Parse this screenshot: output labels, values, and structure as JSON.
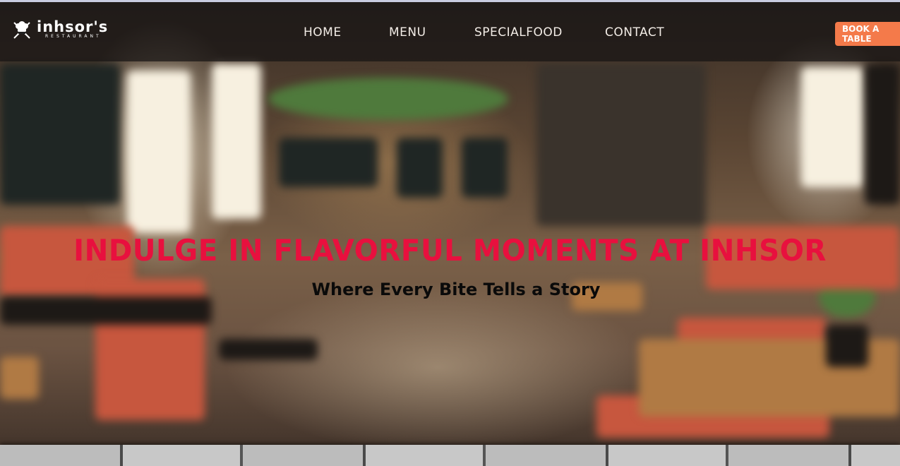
{
  "brand": {
    "name": "inhsor's",
    "tagline": "RESTAURANT",
    "logo_icon": "chef-hat-crossed-utensils-icon"
  },
  "nav": {
    "items": [
      {
        "label": "HOME"
      },
      {
        "label": "MENU"
      },
      {
        "label": "SPECIALFOOD"
      },
      {
        "label": "CONTACT"
      }
    ],
    "cta_label": "BOOK A TABLE"
  },
  "hero": {
    "title": "INDULGE IN FLAVORFUL MOMENTS AT INHSOR",
    "subtitle": "Where Every Bite Tells a Story"
  },
  "colors": {
    "accent": "#f47a4a",
    "title": "#e8103e",
    "nav_bg": "#161413"
  }
}
